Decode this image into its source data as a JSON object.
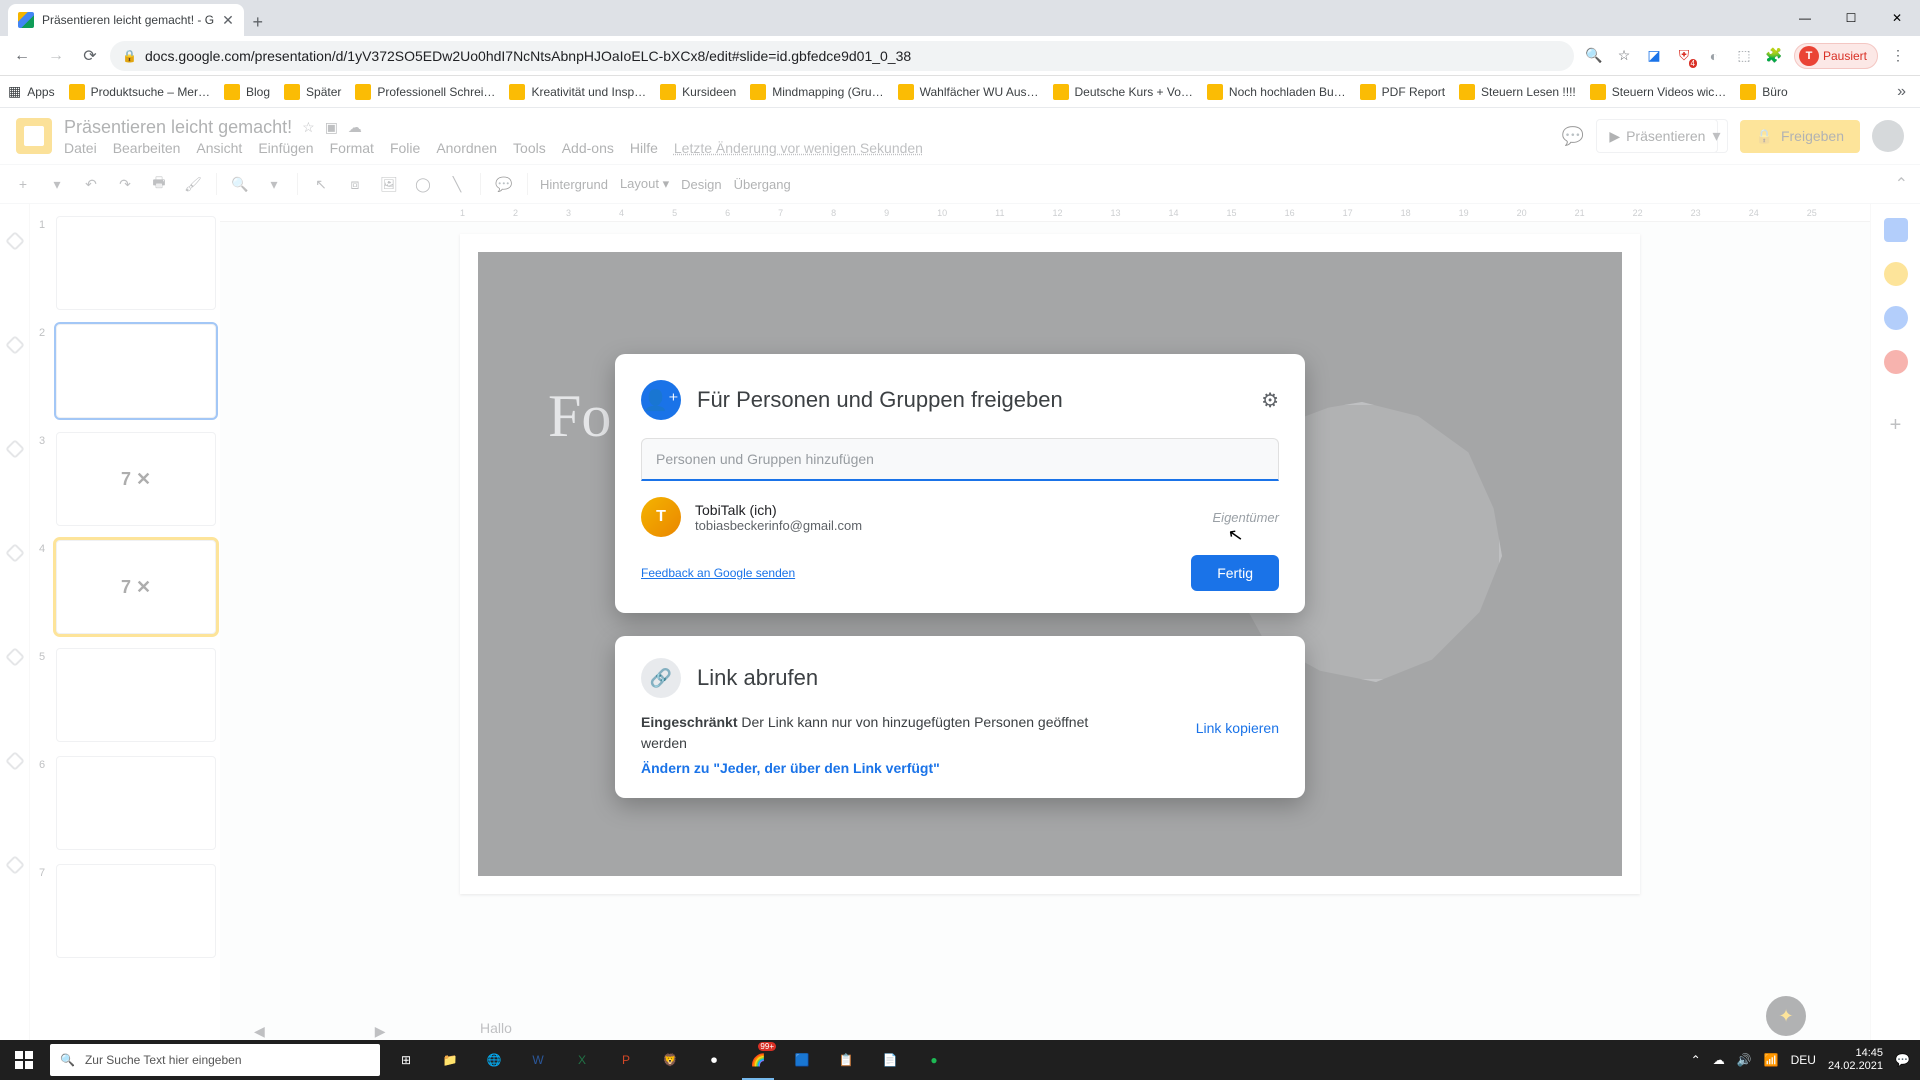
{
  "browser": {
    "tab_title": "Präsentieren leicht gemacht! - G",
    "url": "docs.google.com/presentation/d/1yV372SO5EDw2Uo0hdI7NcNtsAbnpHJOaIoELC-bXCx8/edit#slide=id.gbfedce9d01_0_38",
    "paused_label": "Pausiert",
    "avatar_initial": "T",
    "apps_label": "Apps"
  },
  "bookmarks": [
    "Produktsuche – Mer…",
    "Blog",
    "Später",
    "Professionell Schrei…",
    "Kreativität und Insp…",
    "Kursideen",
    "Mindmapping  (Gru…",
    "Wahlfächer WU Aus…",
    "Deutsche Kurs + Vo…",
    "Noch hochladen Bu…",
    "PDF Report",
    "Steuern Lesen !!!!",
    "Steuern Videos wic…",
    "Büro"
  ],
  "slides": {
    "title": "Präsentieren leicht gemacht!",
    "menus": [
      "Datei",
      "Bearbeiten",
      "Ansicht",
      "Einfügen",
      "Format",
      "Folie",
      "Anordnen",
      "Tools",
      "Add-ons",
      "Hilfe"
    ],
    "history": "Letzte Änderung vor wenigen Sekunden",
    "present": "Präsentieren",
    "share": "Freigeben",
    "toolbar": {
      "bg": "Hintergrund",
      "layout": "Layout ▾",
      "design": "Design",
      "transition": "Übergang"
    },
    "notes": "Hallo",
    "slide_text": "Fo",
    "ruler": [
      "1",
      "2",
      "3",
      "4",
      "5",
      "6",
      "7",
      "8",
      "9",
      "10",
      "11",
      "12",
      "13",
      "14",
      "15",
      "16",
      "17",
      "18",
      "19",
      "20",
      "21",
      "22",
      "23",
      "24",
      "25"
    ],
    "thumbs": [
      {
        "num": "1",
        "txt": ""
      },
      {
        "num": "2",
        "txt": ""
      },
      {
        "num": "3",
        "txt": "7 ✕"
      },
      {
        "num": "4",
        "txt": "7 ✕"
      },
      {
        "num": "5",
        "txt": ""
      },
      {
        "num": "6",
        "txt": ""
      },
      {
        "num": "7",
        "txt": ""
      }
    ]
  },
  "share_dialog": {
    "title": "Für Personen und Gruppen freigeben",
    "placeholder": "Personen und Gruppen hinzufügen",
    "person_name": "TobiTalk (ich)",
    "person_email": "tobiasbeckerinfo@gmail.com",
    "owner": "Eigentümer",
    "feedback": "Feedback an Google senden",
    "done": "Fertig"
  },
  "link_dialog": {
    "title": "Link abrufen",
    "restricted_b": "Eingeschränkt",
    "restricted_rest": " Der Link kann nur von hinzugefügten Personen geöffnet werden",
    "change": "Ändern zu \"Jeder, der über den Link verfügt\"",
    "copy": "Link kopieren"
  },
  "taskbar": {
    "search_placeholder": "Zur Suche Text hier eingeben",
    "lang": "DEU",
    "time": "14:45",
    "date": "24.02.2021",
    "chrome_badge": "99+"
  }
}
